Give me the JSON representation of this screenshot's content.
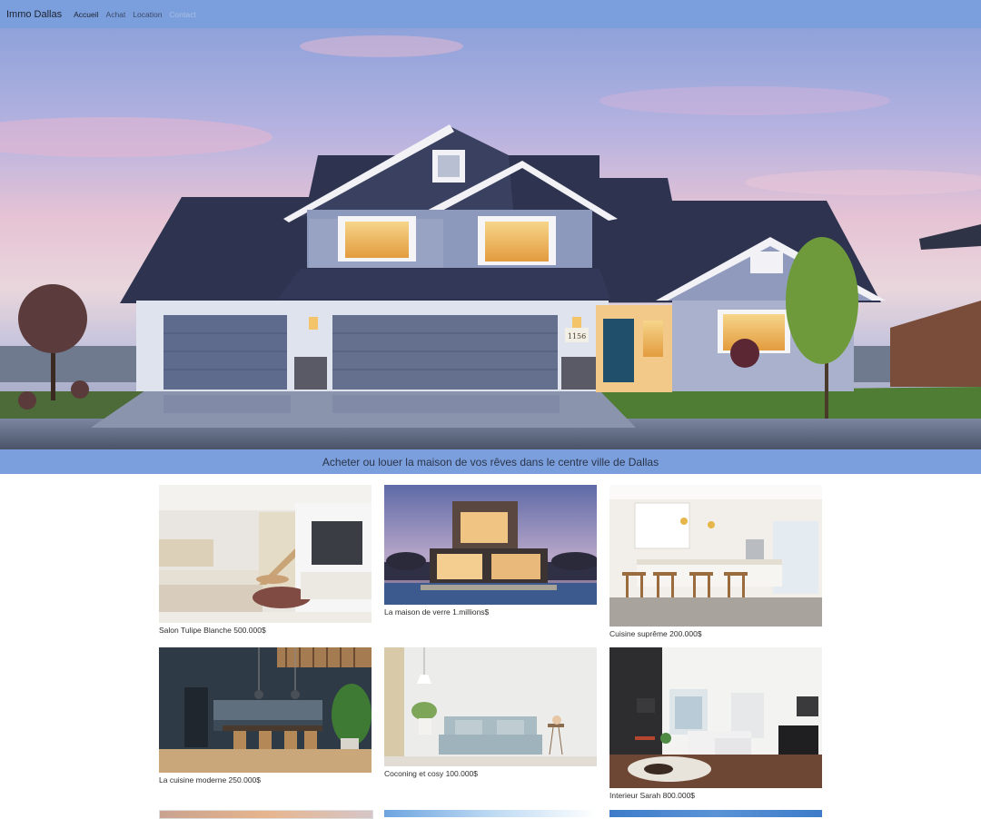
{
  "navbar": {
    "brand": "Immo Dallas",
    "links": [
      {
        "label": "Accueil",
        "state": "active"
      },
      {
        "label": "Achat",
        "state": "normal"
      },
      {
        "label": "Location",
        "state": "normal"
      },
      {
        "label": "Contact",
        "state": "disabled"
      }
    ],
    "color": "#7b9fdd"
  },
  "hero": {
    "banner_text": "Acheter ou louer la maison de vos rêves dans le centre ville de Dallas",
    "house_number": "1156"
  },
  "listings": [
    {
      "caption": "Salon Tulipe Blanche 500.000$"
    },
    {
      "caption": "La maison de verre 1.millions$"
    },
    {
      "caption": "Cuisine suprême 200.000$"
    },
    {
      "caption": "La cuisine moderne 250.000$"
    },
    {
      "caption": "Coconing et cosy 100.000$"
    },
    {
      "caption": "Interieur Sarah 800.000$"
    }
  ]
}
